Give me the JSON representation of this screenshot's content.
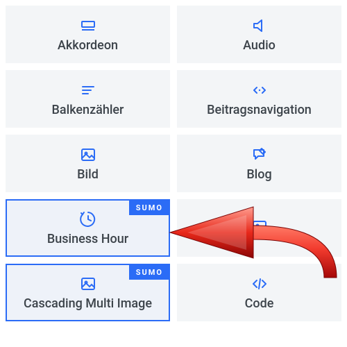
{
  "badge_text": "SUMO",
  "modules": [
    {
      "key": "akkordeon",
      "label": "Akkordeon",
      "icon": "accordion-icon",
      "selected": false,
      "badge": false
    },
    {
      "key": "audio",
      "label": "Audio",
      "icon": "audio-icon",
      "selected": false,
      "badge": false
    },
    {
      "key": "balkenzaehler",
      "label": "Balkenzähler",
      "icon": "bar-counter-icon",
      "selected": false,
      "badge": false
    },
    {
      "key": "beitragsnav",
      "label": "Beitragsnavigation",
      "icon": "post-nav-icon",
      "selected": false,
      "badge": false
    },
    {
      "key": "bild",
      "label": "Bild",
      "icon": "image-icon",
      "selected": false,
      "badge": false
    },
    {
      "key": "blog",
      "label": "Blog",
      "icon": "blog-icon",
      "selected": false,
      "badge": false
    },
    {
      "key": "business-hour",
      "label": "Business Hour",
      "icon": "clock-icon",
      "selected": true,
      "badge": true
    },
    {
      "key": "hidden-module",
      "label": "",
      "icon": "image-icon",
      "selected": false,
      "badge": false
    },
    {
      "key": "cascading",
      "label": "Cascading Multi Image",
      "icon": "image-icon",
      "selected": true,
      "badge": true
    },
    {
      "key": "code",
      "label": "Code",
      "icon": "code-icon",
      "selected": false,
      "badge": false
    }
  ],
  "colors": {
    "accent": "#2b6cf6",
    "tile_bg": "#f3f5f7",
    "tile_bg_selected": "#eef2f9",
    "text": "#3c434a",
    "arrow_light": "#ff6a5a",
    "arrow_dark": "#b90c0c"
  },
  "annotation": {
    "arrow_points_to": "business-hour"
  }
}
